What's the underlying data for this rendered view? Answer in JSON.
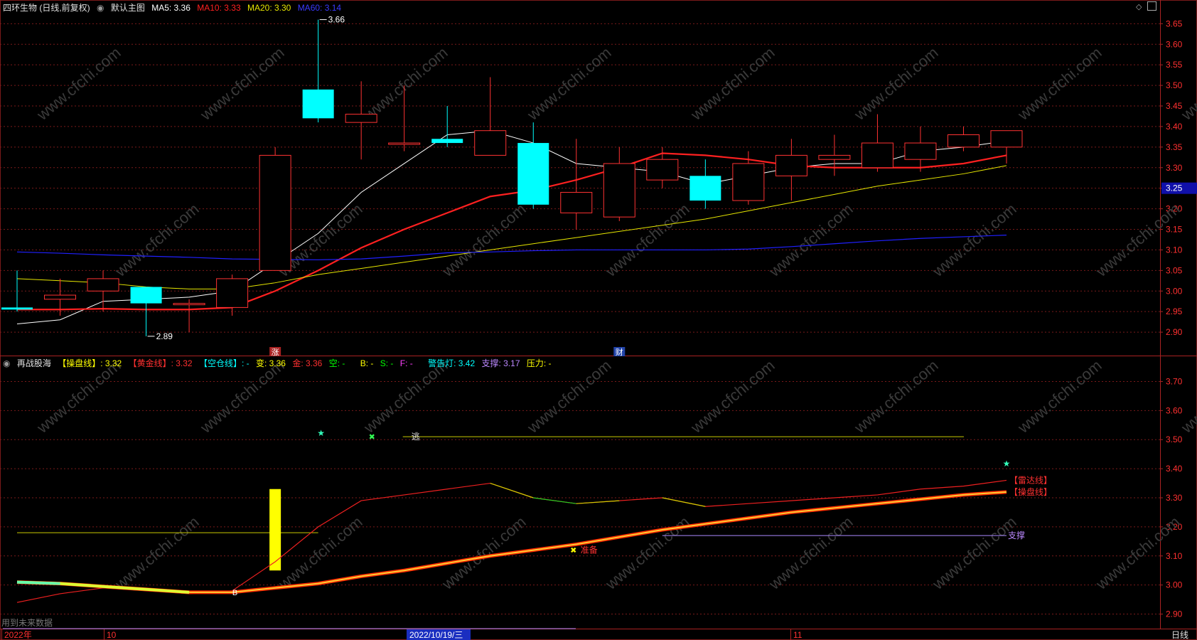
{
  "main_legend": {
    "title": "四环生物 (日线,前复权)",
    "chart_name": "默认主图",
    "ma5": "MA5: 3.36",
    "ma10": "MA10: 3.33",
    "ma20": "MA20: 3.30",
    "ma60": "MA60: 3.14"
  },
  "sub_legend": {
    "name": "再战股海",
    "caopan_label": "【操盘线】: 3.32",
    "huangjin_label": "【黄金线】: 3.32",
    "kongcang_label": "【空仓线】: -",
    "bian_label": "变: 3.36",
    "jin_label": "金: 3.36",
    "kong_label": "空: -",
    "b_label": "B: -",
    "s_label": "S: -",
    "f_label": "F: -",
    "warn_label": "警告灯: 3.42",
    "support_label": "支撑: 3.17",
    "pressure_label": "压力: -"
  },
  "annotations": {
    "high": "3.66",
    "low": "2.89",
    "escape": "逃",
    "prepare": "准备",
    "radar": "【雷达线】",
    "caopan": "【操盘线】",
    "support": "支撑",
    "zhang_marker": "涨",
    "cai_marker": "财",
    "future_data": "用到未来数据",
    "b_marker": "B",
    "current_price": "3.25"
  },
  "time_axis": {
    "labels": [
      "2022年",
      "10",
      "2022/10/19/三",
      "11"
    ],
    "period": "日线"
  },
  "colors": {
    "up": "#ff3232",
    "down": "#00ffff",
    "ma5": "#ffffff",
    "ma10": "#ff2020",
    "ma20": "#e6e600",
    "ma60": "#2020ff",
    "grid": "#7a1a1a"
  },
  "chart_data": [
    {
      "type": "candlestick",
      "title": "四环生物 (日线,前复权)",
      "ylim": [
        2.85,
        3.68
      ],
      "y_ticks": [
        "3.65",
        "3.60",
        "3.55",
        "3.50",
        "3.45",
        "3.40",
        "3.35",
        "3.30",
        "3.25",
        "3.20",
        "3.15",
        "3.10",
        "3.05",
        "3.00",
        "2.95",
        "2.90"
      ],
      "candles": [
        {
          "o": 2.96,
          "h": 3.05,
          "l": 2.95,
          "c": 2.955
        },
        {
          "o": 2.98,
          "h": 3.03,
          "l": 2.94,
          "c": 2.99
        },
        {
          "o": 3.0,
          "h": 3.05,
          "l": 2.95,
          "c": 3.03
        },
        {
          "o": 3.01,
          "h": 3.01,
          "l": 2.89,
          "c": 2.97
        },
        {
          "o": 2.97,
          "h": 2.98,
          "l": 2.9,
          "c": 2.97
        },
        {
          "o": 2.96,
          "h": 3.04,
          "l": 2.94,
          "c": 3.03
        },
        {
          "o": 3.05,
          "h": 3.35,
          "l": 3.05,
          "c": 3.33
        },
        {
          "o": 3.49,
          "h": 3.66,
          "l": 3.41,
          "c": 3.42
        },
        {
          "o": 3.41,
          "h": 3.51,
          "l": 3.32,
          "c": 3.43
        },
        {
          "o": 3.36,
          "h": 3.5,
          "l": 3.34,
          "c": 3.36
        },
        {
          "o": 3.37,
          "h": 3.45,
          "l": 3.35,
          "c": 3.36
        },
        {
          "o": 3.33,
          "h": 3.52,
          "l": 3.33,
          "c": 3.39
        },
        {
          "o": 3.36,
          "h": 3.41,
          "l": 3.2,
          "c": 3.21
        },
        {
          "o": 3.19,
          "h": 3.37,
          "l": 3.15,
          "c": 3.24
        },
        {
          "o": 3.18,
          "h": 3.35,
          "l": 3.17,
          "c": 3.31
        },
        {
          "o": 3.27,
          "h": 3.35,
          "l": 3.25,
          "c": 3.32
        },
        {
          "o": 3.28,
          "h": 3.32,
          "l": 3.2,
          "c": 3.22
        },
        {
          "o": 3.22,
          "h": 3.34,
          "l": 3.21,
          "c": 3.31
        },
        {
          "o": 3.28,
          "h": 3.37,
          "l": 3.22,
          "c": 3.33
        },
        {
          "o": 3.32,
          "h": 3.38,
          "l": 3.28,
          "c": 3.33
        },
        {
          "o": 3.3,
          "h": 3.43,
          "l": 3.29,
          "c": 3.36
        },
        {
          "o": 3.32,
          "h": 3.4,
          "l": 3.29,
          "c": 3.36
        },
        {
          "o": 3.35,
          "h": 3.4,
          "l": 3.34,
          "c": 3.38
        },
        {
          "o": 3.35,
          "h": 3.39,
          "l": 3.31,
          "c": 3.39
        }
      ],
      "series": [
        {
          "name": "MA5",
          "values": [
            2.92,
            2.93,
            2.975,
            2.98,
            2.985,
            3.0,
            3.07,
            3.14,
            3.24,
            3.31,
            3.38,
            3.39,
            3.36,
            3.31,
            3.3,
            3.29,
            3.26,
            3.28,
            3.3,
            3.31,
            3.31,
            3.34,
            3.35,
            3.365
          ]
        },
        {
          "name": "MA10",
          "values": [
            2.955,
            2.955,
            2.957,
            2.955,
            2.955,
            2.96,
            3.0,
            3.05,
            3.105,
            3.15,
            3.19,
            3.23,
            3.245,
            3.27,
            3.3,
            3.335,
            3.33,
            3.32,
            3.305,
            3.3,
            3.3,
            3.3,
            3.31,
            3.33
          ]
        },
        {
          "name": "MA20",
          "values": [
            3.03,
            3.025,
            3.02,
            3.01,
            3.005,
            3.005,
            3.02,
            3.04,
            3.055,
            3.07,
            3.085,
            3.1,
            3.115,
            3.13,
            3.145,
            3.16,
            3.175,
            3.195,
            3.215,
            3.235,
            3.255,
            3.27,
            3.285,
            3.305
          ]
        },
        {
          "name": "MA60",
          "values": [
            3.095,
            3.092,
            3.088,
            3.085,
            3.082,
            3.078,
            3.077,
            3.076,
            3.078,
            3.085,
            3.093,
            3.095,
            3.098,
            3.1,
            3.1,
            3.1,
            3.1,
            3.102,
            3.108,
            3.115,
            3.122,
            3.128,
            3.132,
            3.136
          ]
        }
      ]
    },
    {
      "type": "line",
      "title": "再战股海",
      "ylim": [
        2.85,
        3.75
      ],
      "y_ticks": [
        "3.70",
        "3.60",
        "3.50",
        "3.40",
        "3.30",
        "3.20",
        "3.10",
        "3.00",
        "2.90"
      ],
      "series": [
        {
          "name": "【雷达线】",
          "values": [
            2.94,
            2.97,
            2.99,
            2.98,
            2.97,
            2.98,
            3.08,
            3.2,
            3.29,
            3.31,
            3.33,
            3.35,
            3.3,
            3.28,
            3.29,
            3.3,
            3.27,
            3.28,
            3.29,
            3.3,
            3.31,
            3.33,
            3.34,
            3.36
          ]
        },
        {
          "name": "【操盘线】",
          "values": [
            3.01,
            3.005,
            2.995,
            2.985,
            2.975,
            2.975,
            2.99,
            3.005,
            3.03,
            3.05,
            3.075,
            3.1,
            3.12,
            3.14,
            3.165,
            3.19,
            3.21,
            3.23,
            3.25,
            3.265,
            3.28,
            3.295,
            3.31,
            3.32
          ]
        },
        {
          "name": "支撑",
          "values": [
            3.17,
            3.17
          ]
        }
      ],
      "levels": {
        "escape": 3.51,
        "old_support": 3.18,
        "support": 3.17,
        "warn": 3.42,
        "bar_top": 3.33,
        "bar_bottom": 3.05,
        "prepare": 3.12
      }
    }
  ]
}
